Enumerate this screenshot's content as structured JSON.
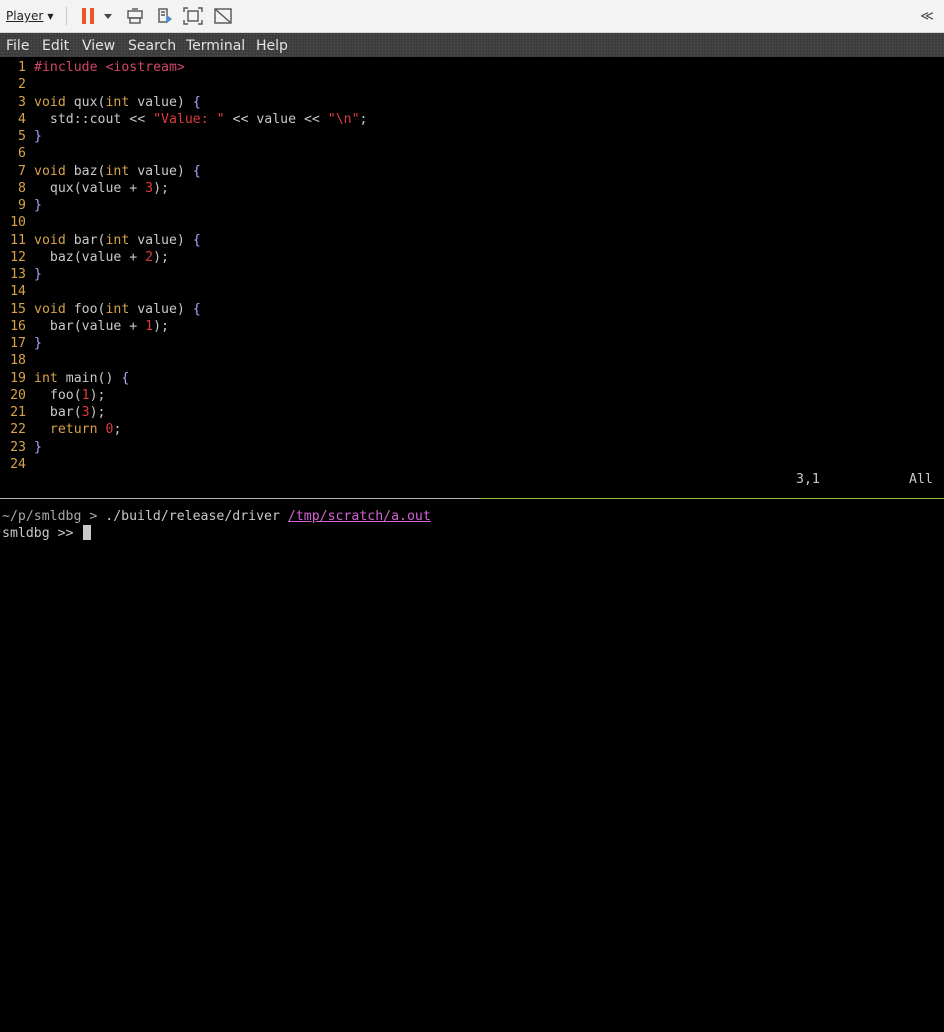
{
  "player": {
    "menu_label": "Player",
    "colors": {
      "pause": "#e8562a",
      "toolbar_bg": "#f3f3f3"
    },
    "icons": [
      "pause-icon",
      "dropdown-icon",
      "send-keys-icon",
      "removable-devices-icon",
      "fit-window-icon",
      "unity-icon",
      "collapse-icon"
    ],
    "collapse_glyph": "≪"
  },
  "menubar": {
    "items": [
      "File",
      "Edit",
      "View",
      "Search",
      "Terminal",
      "Help"
    ]
  },
  "editor": {
    "lines": [
      {
        "n": "1",
        "code": "#include <iostream>"
      },
      {
        "n": "2",
        "code": ""
      },
      {
        "n": "3",
        "code": "void qux(int value) {"
      },
      {
        "n": "4",
        "code": "  std::cout << \"Value: \" << value << \"\\n\";"
      },
      {
        "n": "5",
        "code": "}"
      },
      {
        "n": "6",
        "code": ""
      },
      {
        "n": "7",
        "code": "void baz(int value) {"
      },
      {
        "n": "8",
        "code": "  qux(value + 3);"
      },
      {
        "n": "9",
        "code": "}"
      },
      {
        "n": "10",
        "code": ""
      },
      {
        "n": "11",
        "code": "void bar(int value) {"
      },
      {
        "n": "12",
        "code": "  baz(value + 2);"
      },
      {
        "n": "13",
        "code": "}"
      },
      {
        "n": "14",
        "code": ""
      },
      {
        "n": "15",
        "code": "void foo(int value) {"
      },
      {
        "n": "16",
        "code": "  bar(value + 1);"
      },
      {
        "n": "17",
        "code": "}"
      },
      {
        "n": "18",
        "code": ""
      },
      {
        "n": "19",
        "code": "int main() {"
      },
      {
        "n": "20",
        "code": "  foo(1);"
      },
      {
        "n": "21",
        "code": "  bar(3);"
      },
      {
        "n": "22",
        "code": "  return 0;"
      },
      {
        "n": "23",
        "code": "}"
      },
      {
        "n": "24",
        "code": ""
      }
    ],
    "status": {
      "position": "3,1",
      "scroll": "All"
    }
  },
  "shell": {
    "prompt_path": "~/p/smldbg",
    "prompt_symbol": ">",
    "command": "./build/release/driver",
    "argument": "/tmp/scratch/a.out",
    "debugger_prompt": "smldbg >>"
  }
}
